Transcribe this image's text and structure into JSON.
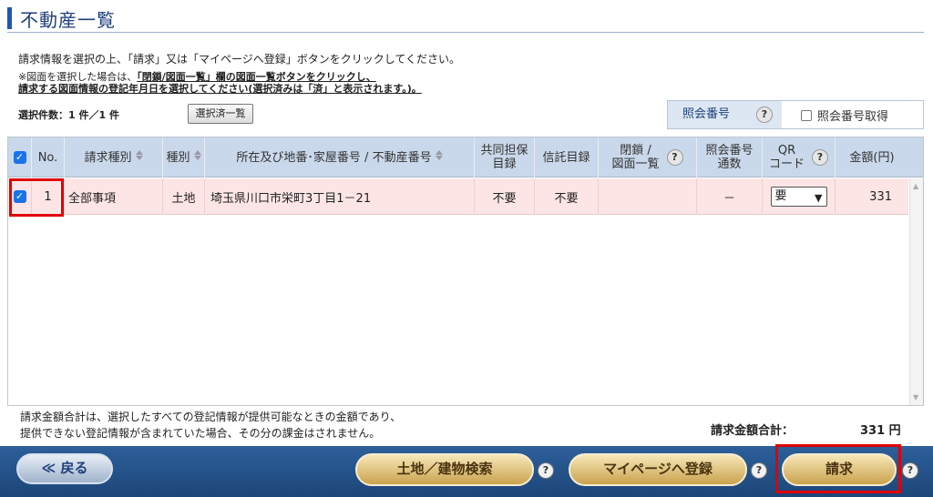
{
  "header": {
    "title": "不動産一覧"
  },
  "instructions": {
    "main": "請求情報を選択の上、「請求」又は「マイページへ登録」ボタンをクリックしてください。",
    "note1_prefix": "※図面を選択した場合は、",
    "note1_link": "「閉鎖/図面一覧」欄の図面一覧ボタンをクリックし、",
    "note2": "請求する図面情報の登記年月日を選択してください(選択済みは「済」と表示されます。)。"
  },
  "selection": {
    "count_label": "選択件数：1 件／1 件",
    "list_button": "選択済一覧"
  },
  "shokai": {
    "label": "照会番号",
    "help": "?",
    "checkbox_label": "照会番号取得"
  },
  "table": {
    "headers": {
      "check": "✓",
      "no": "No.",
      "request_type": "請求種別",
      "kind": "種別",
      "location": "所在及び地番･家屋番号 / 不動産番号",
      "joint_collateral": "共同担保\n目録",
      "trust": "信託目録",
      "closed": "閉鎖 /\n図面一覧",
      "closed_help": "?",
      "inquiry_count": "照会番号\n通数",
      "qr": "QR\nコード",
      "qr_help": "?",
      "amount": "金額(円)"
    },
    "rows": [
      {
        "checked": "✓",
        "no": "1",
        "request_type": "全部事項",
        "kind": "土地",
        "location": "埼玉県川口市栄町3丁目1－21",
        "joint_collateral": "不要",
        "trust": "不要",
        "closed": "",
        "inquiry_count": "－",
        "qr": "要",
        "amount": "331"
      }
    ]
  },
  "footer": {
    "note_line1": "請求金額合計は、選択したすべての登記情報が提供可能なときの金額であり、",
    "note_line2": "提供できない登記情報が含まれていた場合、その分の課金はされません。",
    "total_label": "請求金額合計：",
    "total_value": "331 円"
  },
  "buttons": {
    "back": "≪ 戻る",
    "search": "土地／建物検索",
    "register": "マイページへ登録",
    "request": "請求",
    "help": "?"
  },
  "colors": {
    "header_blue": "#1f3f7a",
    "row_highlight": "#fde5e5",
    "bar_blue": "#1c4679",
    "annotation_red": "#e00000"
  }
}
